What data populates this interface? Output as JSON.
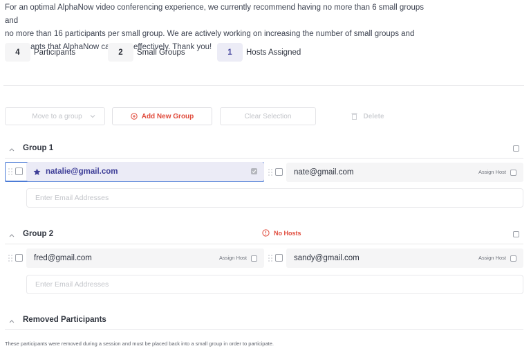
{
  "intro": {
    "line1": "For an optimal AlphaNow video conferencing experience, we currently recommend having no more than 6 small groups and",
    "line2": "no more than 16 participants per small group. We are actively working on increasing the number of small groups and",
    "line3": "participants that AlphaNow can host effectively. Thank you!"
  },
  "stats": [
    {
      "value": "4",
      "label": "Participants"
    },
    {
      "value": "2",
      "label": "Small Groups"
    },
    {
      "value": "1",
      "label": "Hosts Assigned"
    }
  ],
  "toolbar": {
    "move_label": "Move to a group",
    "add_label": "Add New Group",
    "clear_label": "Clear Selection",
    "delete_label": "Delete"
  },
  "groups": [
    {
      "title": "Group 1",
      "warning": null,
      "participants": [
        {
          "email": "natalie@gmail.com",
          "is_host": true,
          "selected": true
        },
        {
          "email": "nate@gmail.com",
          "is_host": false,
          "assign_label": "Assign Host"
        }
      ],
      "input_placeholder": "Enter Email Addresses"
    },
    {
      "title": "Group 2",
      "warning": "No Hosts",
      "participants": [
        {
          "email": "fred@gmail.com",
          "is_host": false,
          "assign_label": "Assign Host"
        },
        {
          "email": "sandy@gmail.com",
          "is_host": false,
          "assign_label": "Assign Host"
        }
      ],
      "input_placeholder": "Enter Email Addresses"
    }
  ],
  "removed": {
    "title": "Removed Participants",
    "note": "These participants were removed during a session and must be placed back into a small group in order to participate."
  },
  "colors": {
    "accent_red": "#e04b3c",
    "host_purple": "#3f3f98",
    "selection_blue": "#4b7bd6"
  }
}
